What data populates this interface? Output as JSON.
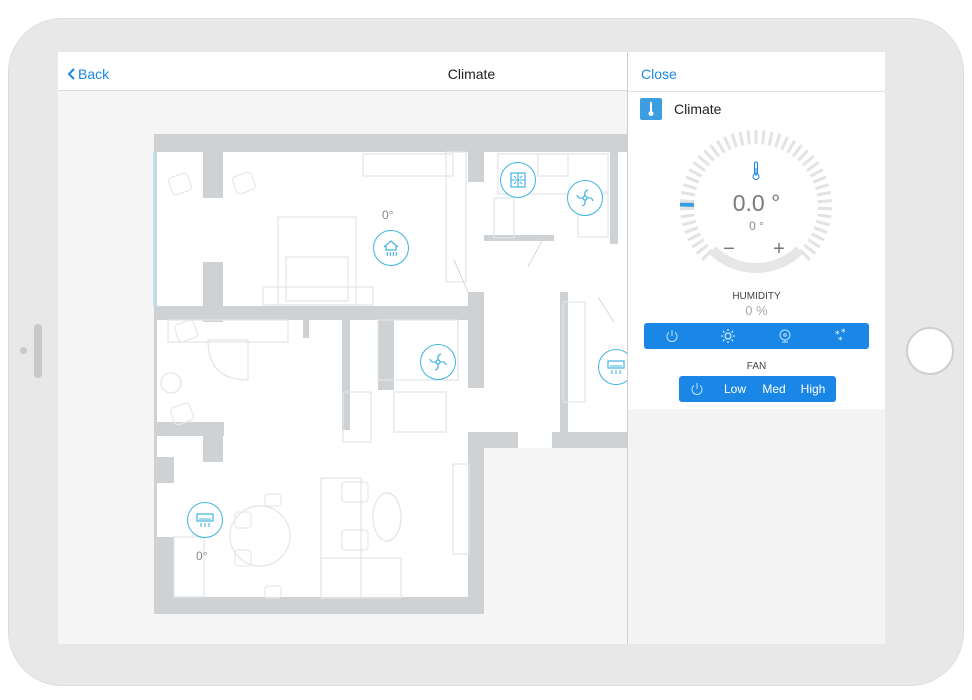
{
  "header": {
    "back_label": "Back",
    "title": "Climate"
  },
  "floorplan": {
    "devices": [
      {
        "name": "floor-heating",
        "icon": "floor-heating-icon",
        "value": "0°"
      },
      {
        "name": "bathroom-fan",
        "icon": "fan-icon"
      },
      {
        "name": "ventilation",
        "icon": "ventilation-icon"
      },
      {
        "name": "hallway-fan",
        "icon": "fan-icon"
      },
      {
        "name": "ac-right",
        "icon": "air-conditioner-icon"
      },
      {
        "name": "ac-dining",
        "icon": "air-conditioner-icon",
        "value": "0°"
      }
    ]
  },
  "panel": {
    "close_label": "Close",
    "device_name": "Climate",
    "device_icon": "thermometer-icon",
    "temperature": "0.0 °",
    "target": "0 °",
    "minus": "−",
    "plus": "+",
    "humidity_label": "HUMIDITY",
    "humidity_value": "0 %",
    "modes": [
      "power-icon",
      "sun-icon",
      "fan-icon",
      "snowflake-icon"
    ],
    "fan_label": "FAN",
    "fan_options": [
      "Low",
      "Med",
      "High"
    ]
  },
  "colors": {
    "accent": "#1a87e6",
    "device_ring": "#41b4e0",
    "wall": "#cfd2d5"
  }
}
